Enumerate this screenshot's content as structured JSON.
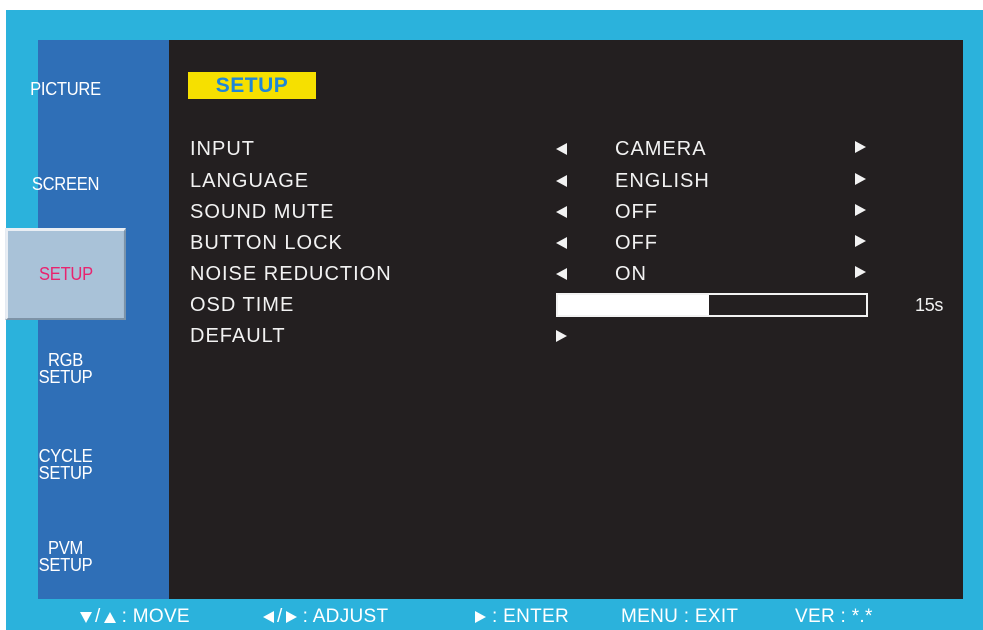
{
  "sidebar": {
    "items": [
      {
        "label": "PICTURE"
      },
      {
        "label": "SCREEN"
      },
      {
        "label": "SETUP"
      },
      {
        "label": "RGB\nSETUP"
      },
      {
        "label": "CYCLE\nSETUP"
      },
      {
        "label": "PVM\nSETUP"
      }
    ],
    "active_index": 2
  },
  "menu": {
    "title": "SETUP",
    "rows": [
      {
        "label": "INPUT",
        "value": "CAMERA"
      },
      {
        "label": "LANGUAGE",
        "value": "ENGLISH"
      },
      {
        "label": "SOUND MUTE",
        "value": "OFF"
      },
      {
        "label": "BUTTON LOCK",
        "value": "OFF"
      },
      {
        "label": "NOISE REDUCTION",
        "value": "ON"
      }
    ],
    "osd_time": {
      "label": "OSD TIME",
      "value_text": "15s",
      "fill_fraction": 0.49
    },
    "default": {
      "label": "DEFAULT"
    }
  },
  "footer": {
    "move": ": MOVE",
    "adjust": ": ADJUST",
    "enter": ": ENTER",
    "exit": "MENU : EXIT",
    "version": "VER : *.*"
  },
  "icons": [
    "triangle-left-icon",
    "triangle-right-icon",
    "triangle-up-icon",
    "triangle-down-icon"
  ],
  "colors": {
    "frame": "#2bb2dc",
    "sidebar": "#2f6fb7",
    "active_tab_bg": "#a9c2d8",
    "active_tab_text": "#e8246f",
    "panel": "#231f20",
    "title_bg": "#f6e000",
    "title_text": "#1f86d6"
  }
}
